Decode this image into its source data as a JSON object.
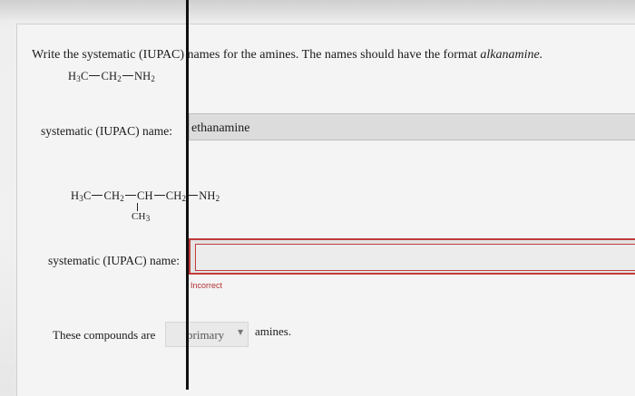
{
  "question": {
    "text": "Write the systematic (IUPAC) names for the amines. The names should have the format ",
    "format_hint": "alkanamine."
  },
  "compound1": {
    "formula": {
      "a": "H",
      "a_sub": "3",
      "b": "C",
      "c": "CH",
      "c_sub": "2",
      "d": "NH",
      "d_sub": "2"
    },
    "label": "systematic (IUPAC) name:",
    "answer": "ethanamine"
  },
  "compound2": {
    "formula": {
      "p1": "H",
      "p1_sub": "3",
      "p2": "C",
      "p3": "CH",
      "p3_sub": "2",
      "p4": "CH",
      "p5": "CH",
      "p5_sub": "2",
      "p6": "NH",
      "p6_sub": "2",
      "branch": "CH",
      "branch_sub": "3"
    },
    "label": "systematic (IUPAC) name:",
    "answer": "",
    "feedback": "Incorrect",
    "feedback_color": "#b23030"
  },
  "classification": {
    "prefix": "These compounds are",
    "selected": "primary",
    "suffix": "amines."
  }
}
